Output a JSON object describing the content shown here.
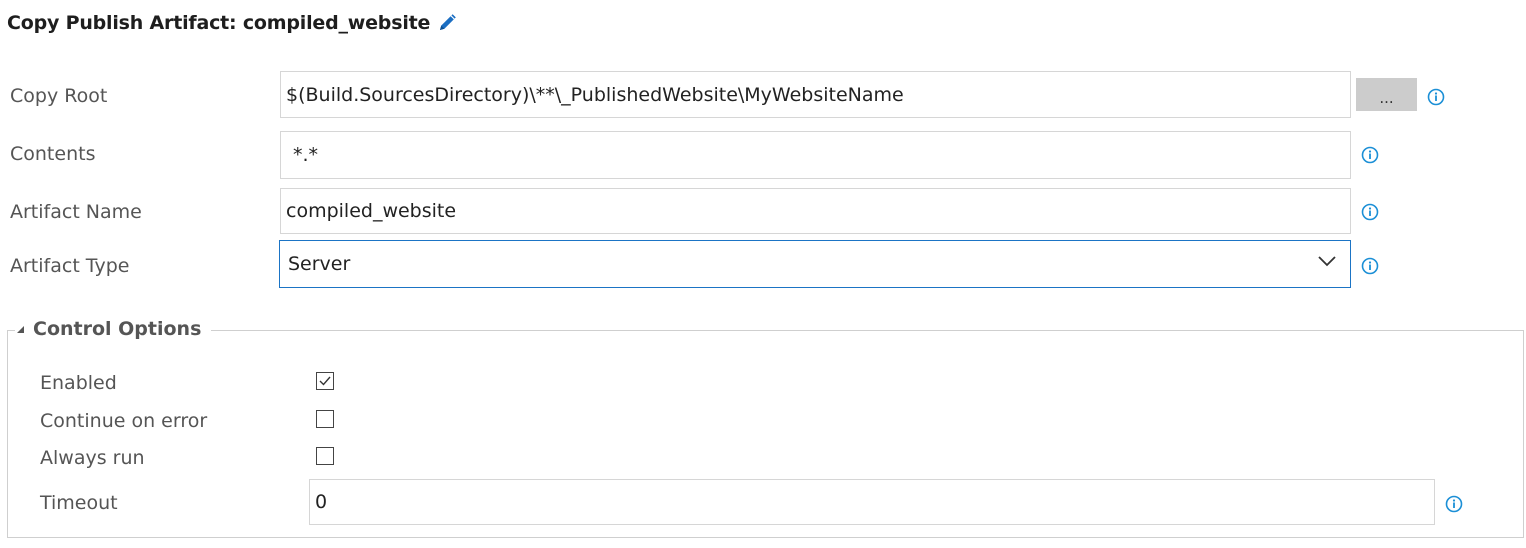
{
  "header": {
    "title": "Copy Publish Artifact: compiled_website",
    "edit_icon": "pencil-icon"
  },
  "fields": {
    "copy_root": {
      "label": "Copy Root",
      "value": "$(Build.SourcesDirectory)\\**\\_PublishedWebsite\\MyWebsiteName",
      "browse_label": "..."
    },
    "contents": {
      "label": "Contents",
      "value": "*.*"
    },
    "artifact_name": {
      "label": "Artifact Name",
      "value": "compiled_website"
    },
    "artifact_type": {
      "label": "Artifact Type",
      "value": "Server"
    }
  },
  "control_options": {
    "title": "Control Options",
    "enabled": {
      "label": "Enabled",
      "checked": true
    },
    "continue_on_error": {
      "label": "Continue on error",
      "checked": false
    },
    "always_run": {
      "label": "Always run",
      "checked": false
    },
    "timeout": {
      "label": "Timeout",
      "value": "0"
    }
  },
  "colors": {
    "info_icon": "#1b8fd6",
    "select_border": "#1b74c5",
    "pencil": "#1b6ec2"
  }
}
